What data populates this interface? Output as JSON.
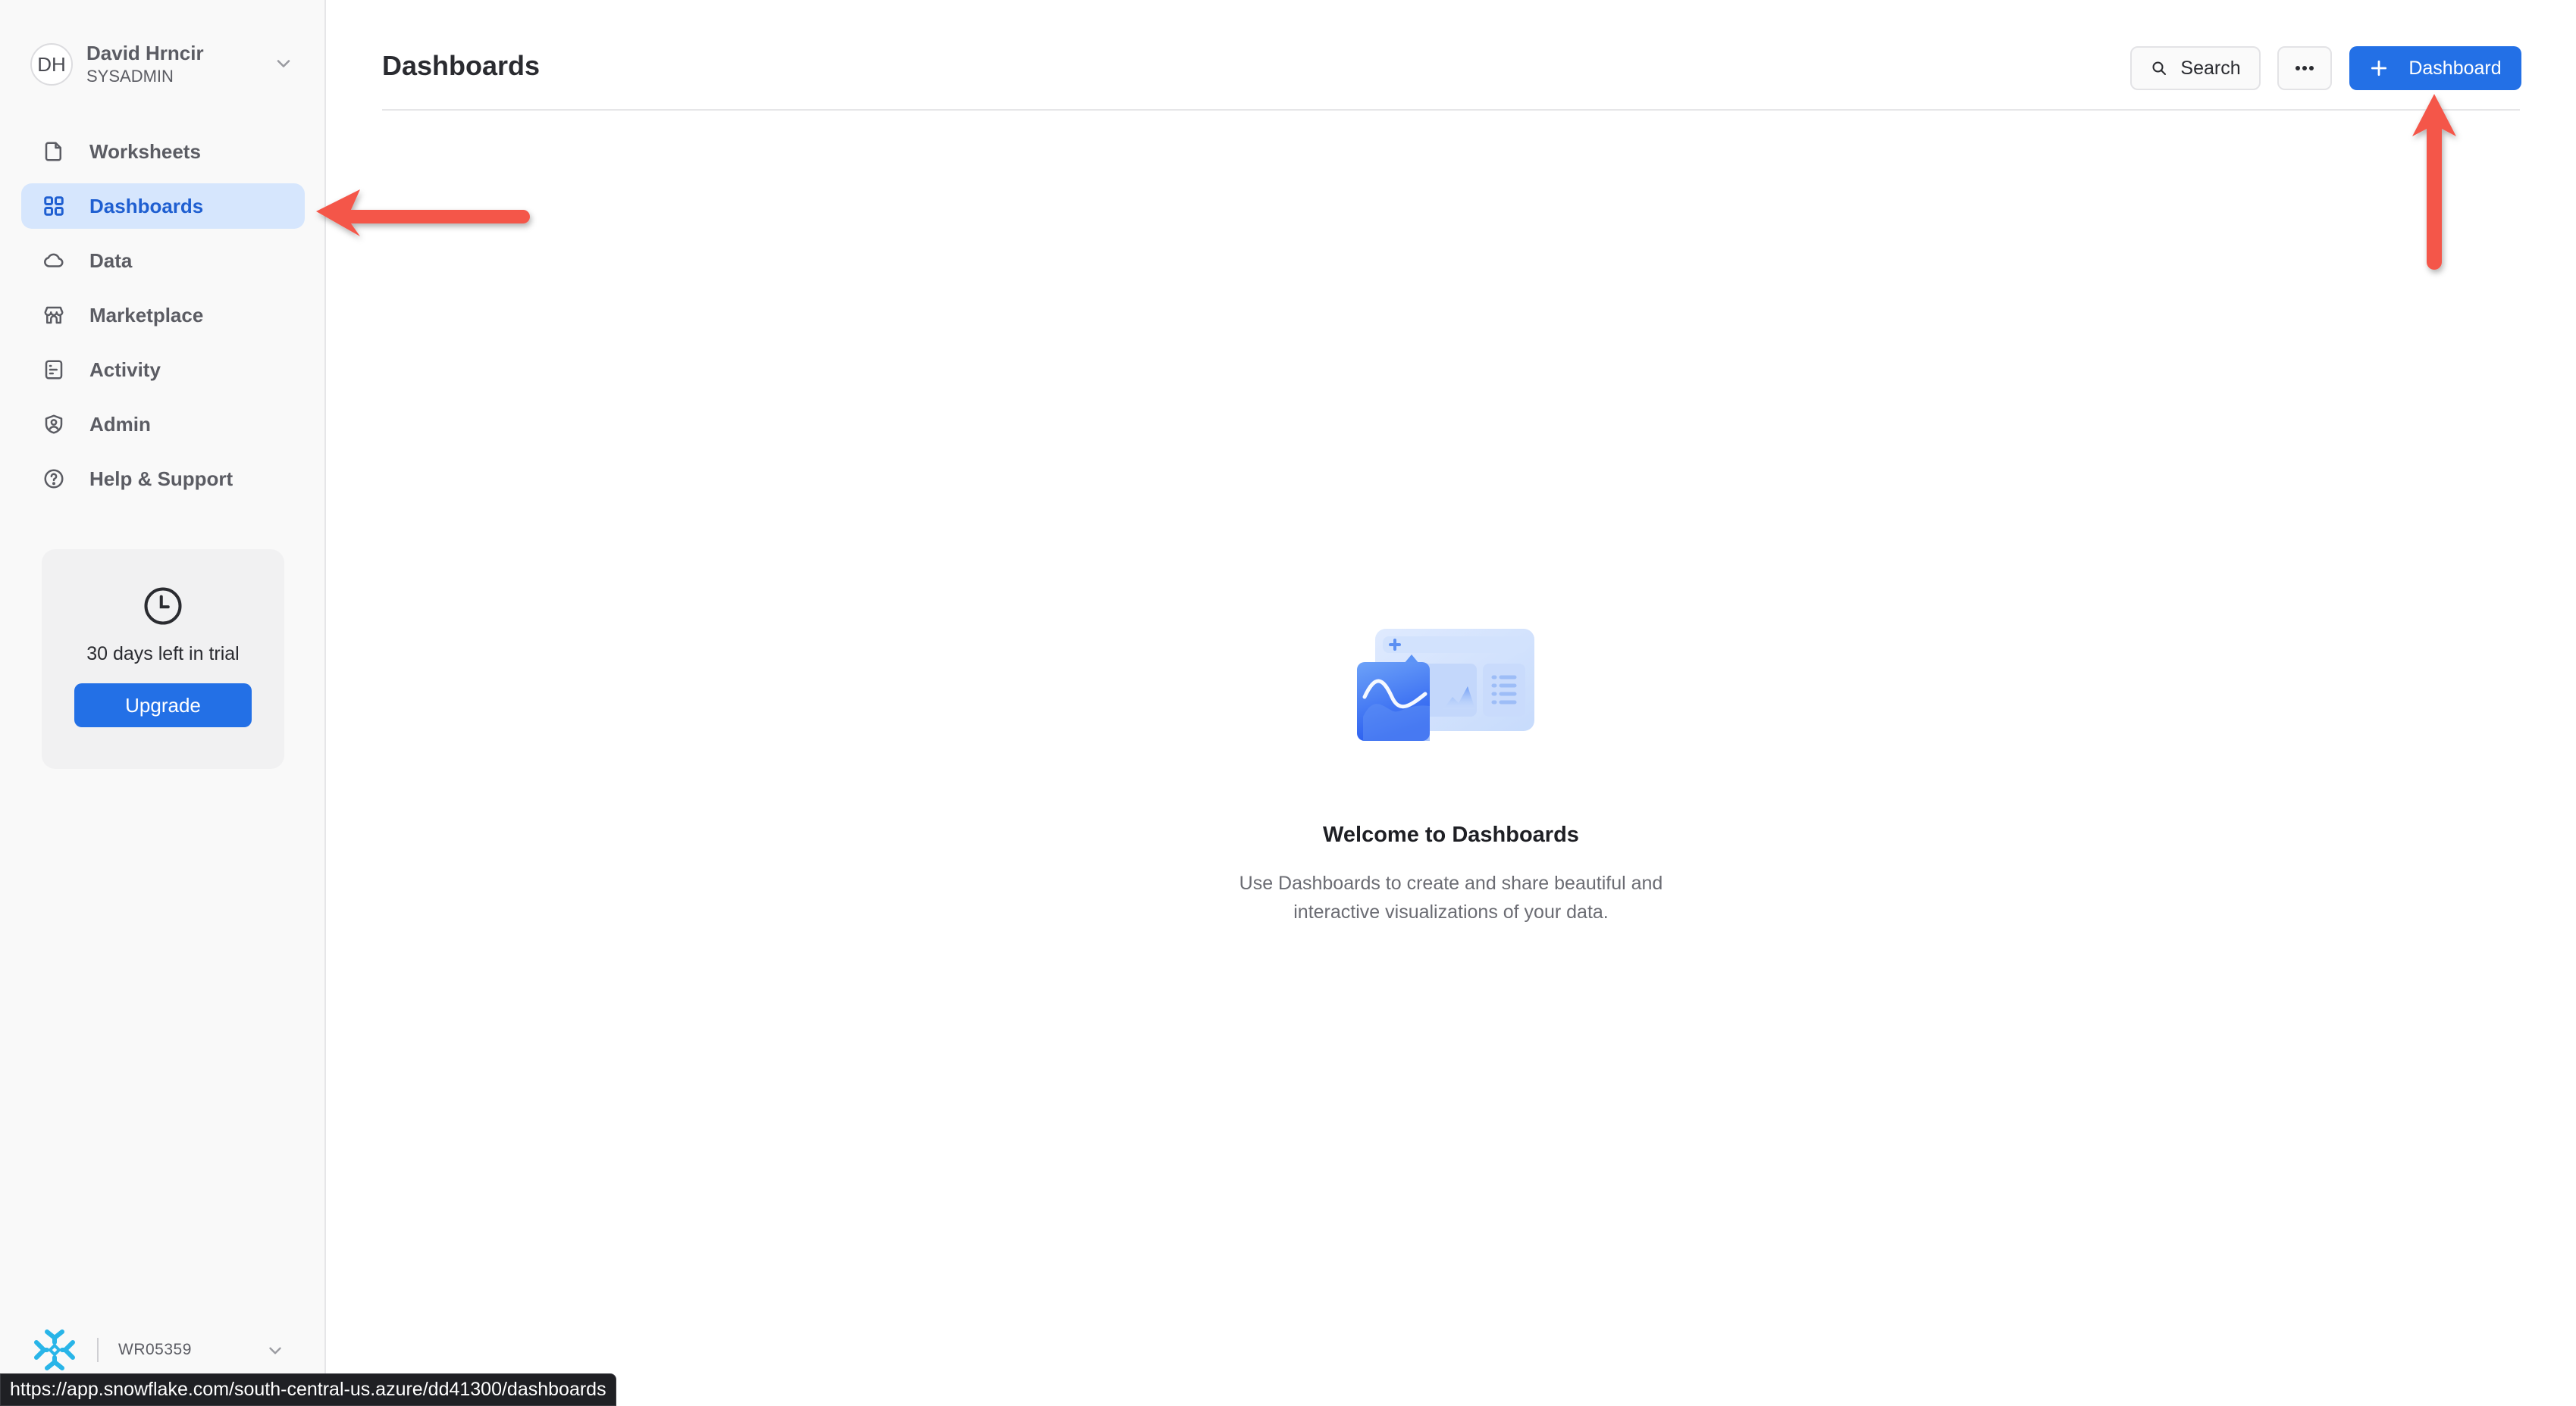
{
  "user": {
    "initials": "DH",
    "name": "David Hrncir",
    "role": "SYSADMIN"
  },
  "sidebar": {
    "items": [
      {
        "label": "Worksheets",
        "icon": "file-icon",
        "active": false
      },
      {
        "label": "Dashboards",
        "icon": "grid-icon",
        "active": true
      },
      {
        "label": "Data",
        "icon": "cloud-icon",
        "active": false
      },
      {
        "label": "Marketplace",
        "icon": "storefront-icon",
        "active": false
      },
      {
        "label": "Activity",
        "icon": "activity-log-icon",
        "active": false
      },
      {
        "label": "Admin",
        "icon": "shield-user-icon",
        "active": false
      },
      {
        "label": "Help & Support",
        "icon": "help-circle-icon",
        "active": false
      }
    ],
    "trial": {
      "icon": "clock-icon",
      "text": "30 days left in trial",
      "button_label": "Upgrade"
    },
    "account": {
      "logo": "snowflake-logo",
      "name": "WR05359"
    }
  },
  "header": {
    "title": "Dashboards",
    "search_label": "Search",
    "more_icon": "ellipsis-icon",
    "create_label": "Dashboard",
    "create_icon": "plus-icon"
  },
  "empty_state": {
    "illustration": "dashboard-illustration",
    "title": "Welcome to Dashboards",
    "description": "Use Dashboards to create and share beautiful and interactive visualizations of your data."
  },
  "status_bar": {
    "url": "https://app.snowflake.com/south-central-us.azure/dd41300/dashboards"
  },
  "colors": {
    "accent": "#2370e6",
    "active_nav_bg": "#d6e6fd",
    "active_nav_text": "#1f5fd1",
    "annotation_arrow": "#f4574a",
    "snowflake_logo": "#29b5e8"
  }
}
